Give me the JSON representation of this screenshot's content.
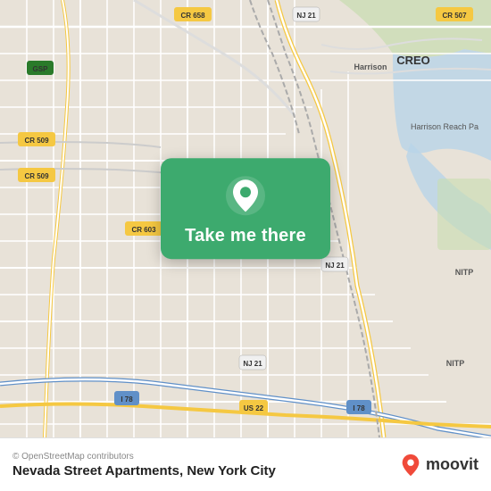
{
  "map": {
    "attribution": "© OpenStreetMap contributors",
    "center": {
      "lat": 40.748,
      "lng": -74.155
    }
  },
  "popup": {
    "label": "Take me there"
  },
  "bottom_bar": {
    "location_name": "Nevada Street Apartments, New York City",
    "copyright": "© OpenStreetMap contributors",
    "brand": "moovit"
  },
  "road_labels": [
    "CR 658",
    "NJ 21",
    "CR 507",
    "GSP",
    "CR 509",
    "CR 509",
    "CR 603",
    "Harrison",
    "Harrison Reach Pa",
    "NJ 21",
    "NITP",
    "NJ 21",
    "I 78",
    "US 22",
    "I 78",
    "NITP"
  ],
  "icons": {
    "pin": "location-pin-icon",
    "moovit_pin": "moovit-brand-icon"
  }
}
